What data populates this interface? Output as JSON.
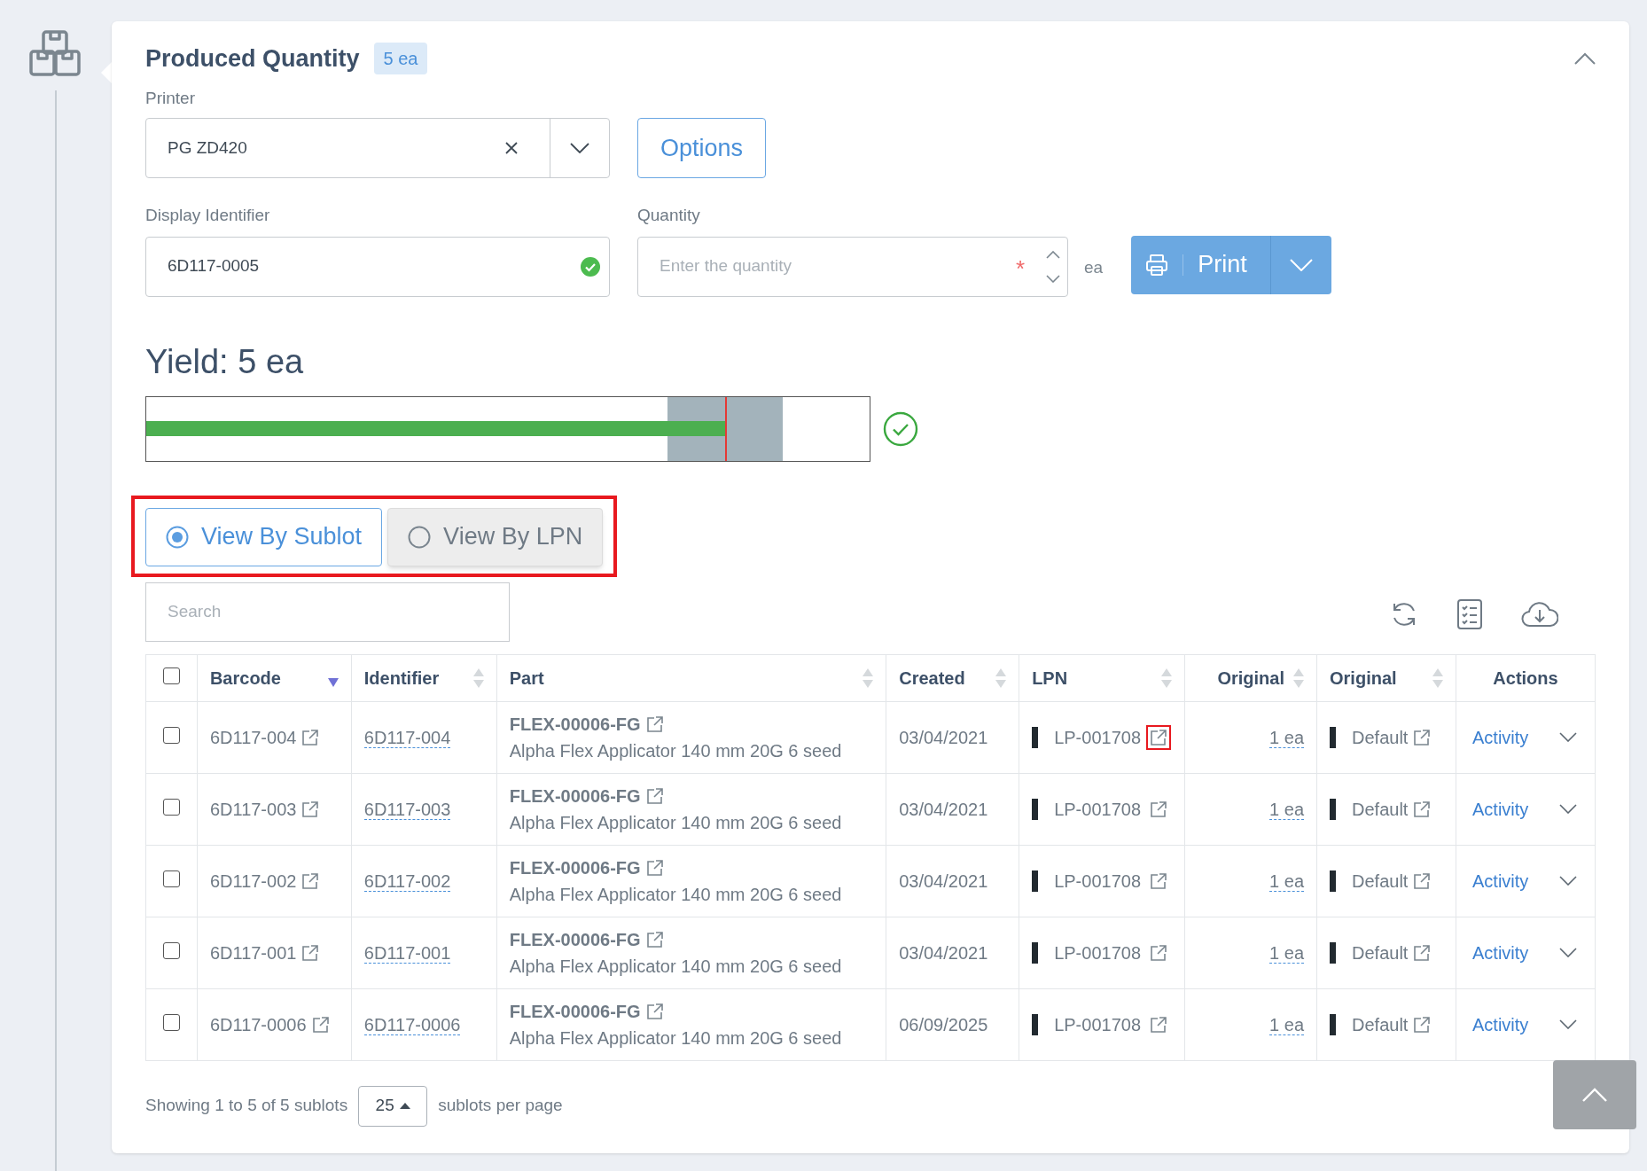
{
  "section": {
    "title": "Produced Quantity",
    "badge": "5 ea"
  },
  "printer": {
    "label": "Printer",
    "value": "PG ZD420"
  },
  "options_button": "Options",
  "display_identifier": {
    "label": "Display Identifier",
    "value": "6D117-0005",
    "valid": true
  },
  "quantity": {
    "label": "Quantity",
    "placeholder": "Enter the quantity",
    "required_mark": "*",
    "unit": "ea"
  },
  "print_button": "Print",
  "yield": {
    "title": "Yield: 5 ea",
    "level": 0.8,
    "ok": true
  },
  "view_toggle": {
    "highlighted": true,
    "options": [
      {
        "label": "View By Sublot",
        "selected": true
      },
      {
        "label": "View By LPN",
        "selected": false
      }
    ]
  },
  "search": {
    "placeholder": "Search"
  },
  "table": {
    "header_checked": false,
    "columns": [
      {
        "label": "Barcode",
        "sortable": true,
        "sorted_descending": true
      },
      {
        "label": "Identifier",
        "sortable": true,
        "sorted_descending": false
      },
      {
        "label": "Part",
        "sortable": true,
        "sorted_descending": false
      },
      {
        "label": "Created",
        "sortable": true,
        "sorted_descending": false
      },
      {
        "label": "LPN",
        "sortable": true,
        "sorted_descending": false
      },
      {
        "label": "Original",
        "sortable": true,
        "sorted_descending": false
      },
      {
        "label": "Original",
        "sortable": true,
        "sorted_descending": false
      },
      {
        "label": "Actions",
        "sortable": false
      }
    ],
    "rows": [
      {
        "checked": false,
        "barcode": "6D117-004",
        "identifier": "6D117-004",
        "part_number": "FLEX-00006-FG",
        "part_description": "Alpha Flex Applicator 140 mm 20G 6 seed",
        "created": "03/04/2021",
        "lpn": "LP-001708",
        "lpn_link_highlighted": true,
        "original_quantity": "1 ea",
        "original_location": "Default",
        "action": "Activity"
      },
      {
        "checked": false,
        "barcode": "6D117-003",
        "identifier": "6D117-003",
        "part_number": "FLEX-00006-FG",
        "part_description": "Alpha Flex Applicator 140 mm 20G 6 seed",
        "created": "03/04/2021",
        "lpn": "LP-001708",
        "lpn_link_highlighted": false,
        "original_quantity": "1 ea",
        "original_location": "Default",
        "action": "Activity"
      },
      {
        "checked": false,
        "barcode": "6D117-002",
        "identifier": "6D117-002",
        "part_number": "FLEX-00006-FG",
        "part_description": "Alpha Flex Applicator 140 mm 20G 6 seed",
        "created": "03/04/2021",
        "lpn": "LP-001708",
        "lpn_link_highlighted": false,
        "original_quantity": "1 ea",
        "original_location": "Default",
        "action": "Activity"
      },
      {
        "checked": false,
        "barcode": "6D117-001",
        "identifier": "6D117-001",
        "part_number": "FLEX-00006-FG",
        "part_description": "Alpha Flex Applicator 140 mm 20G 6 seed",
        "created": "03/04/2021",
        "lpn": "LP-001708",
        "lpn_link_highlighted": false,
        "original_quantity": "1 ea",
        "original_location": "Default",
        "action": "Activity"
      },
      {
        "checked": false,
        "barcode": "6D117-0006",
        "identifier": "6D117-0006",
        "part_number": "FLEX-00006-FG",
        "part_description": "Alpha Flex Applicator 140 mm 20G 6 seed",
        "created": "06/09/2025",
        "lpn": "LP-001708",
        "lpn_link_highlighted": false,
        "original_quantity": "1 ea",
        "original_location": "Default",
        "action": "Activity"
      }
    ]
  },
  "footer": {
    "showing": "Showing 1 to 5 of 5 sublots",
    "per_page": "25",
    "per_page_suffix": "sublots per page"
  }
}
